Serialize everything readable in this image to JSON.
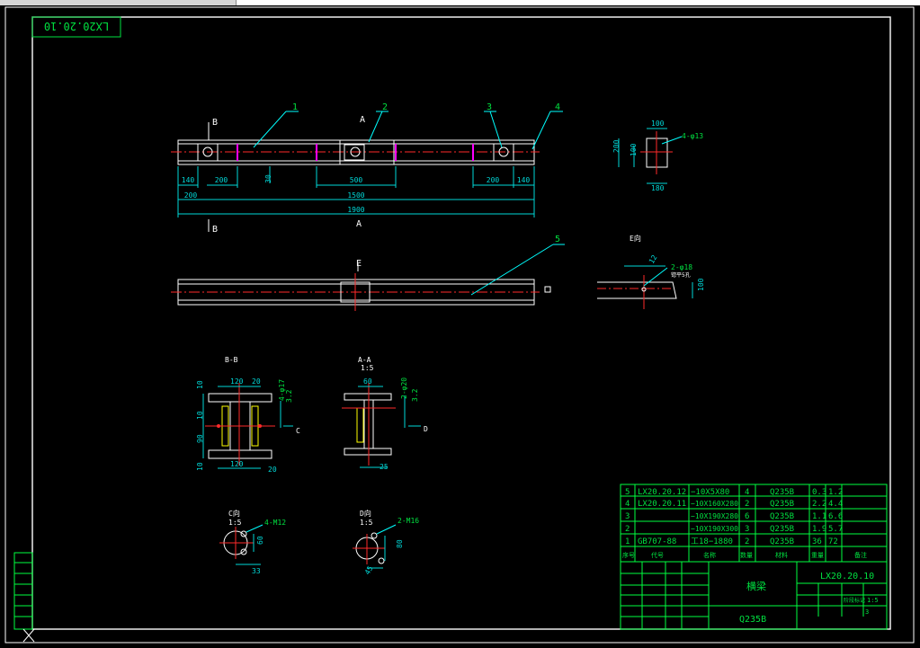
{
  "drawing_number_stamp": "LX20.20.10",
  "plan_view": {
    "part_callouts": [
      "1",
      "2",
      "3",
      "4"
    ],
    "section_labels": {
      "b_left": "B",
      "a_top": "A",
      "b_bottom": "B",
      "a_bottom": "A"
    },
    "dimensions": [
      "140",
      "200",
      "30",
      "500",
      "200",
      "140",
      "200",
      "1500",
      "1900"
    ]
  },
  "side_view": {
    "part_callout": "5",
    "view_label": "E"
  },
  "end_view": {
    "dims": [
      "100",
      "200",
      "100",
      "180"
    ],
    "hole_note": "4-φ13"
  },
  "detail_e": {
    "label": "E向",
    "note": "2-φ18",
    "sub_note": "锪平5孔",
    "dims": [
      "12",
      "100"
    ]
  },
  "section_bb": {
    "title": "B-B",
    "dims": [
      "120",
      "20",
      "10",
      "10",
      "90",
      "10",
      "120",
      "20",
      "4-φ17",
      "3.2"
    ],
    "arrow_label": "C"
  },
  "section_aa": {
    "title": "A-A",
    "scale": "1:5",
    "dims": [
      "60",
      "2-φ20",
      "3.2",
      "25"
    ],
    "arrow_label": "D"
  },
  "view_c": {
    "title": "C向",
    "scale": "1:5",
    "note": "4-M12",
    "dims": [
      "60",
      "33"
    ]
  },
  "view_d": {
    "title": "D向",
    "scale": "1:5",
    "note": "2-M16",
    "dims": [
      "80",
      "45"
    ]
  },
  "bom": {
    "rows": [
      {
        "no": "5",
        "code": "LX20.20.12",
        "name": "−10X5X80",
        "qty": "4",
        "mat": "Q235B",
        "w1": "0.3",
        "w2": "1.2"
      },
      {
        "no": "4",
        "code": "LX20.20.11",
        "name": "−10X160X280",
        "qty": "2",
        "mat": "Q235B",
        "w1": "2.2",
        "w2": "4.4"
      },
      {
        "no": "3",
        "code": "",
        "name": "−10X190X280",
        "qty": "6",
        "mat": "Q235B",
        "w1": "1.1",
        "w2": "6.6"
      },
      {
        "no": "2",
        "code": "",
        "name": "−10X190X300",
        "qty": "3",
        "mat": "Q235B",
        "w1": "1.9",
        "w2": "5.7"
      },
      {
        "no": "1",
        "code": "GB707-88",
        "name": "工18−1880",
        "qty": "2",
        "mat": "Q235B",
        "w1": "36",
        "w2": "72"
      }
    ],
    "header": {
      "no": "序号",
      "code": "代号",
      "name": "名称",
      "qty": "数量",
      "mat": "材料",
      "weight": "重量",
      "note": "备注"
    }
  },
  "title_block": {
    "part_name": "横梁",
    "material": "Q235B",
    "drawing_no": "LX20.20.10",
    "scale": "1:5",
    "mark": "阶段标记",
    "count": "3"
  },
  "colors": {
    "border": "#ffffff",
    "geometry": "#ffffff",
    "centerline": "#ff2a2a",
    "dimension": "#00d8d8",
    "text": "#00e040",
    "hatch_part": "#ff00ff",
    "block": "#00ff40",
    "leader": "#00ffff"
  }
}
